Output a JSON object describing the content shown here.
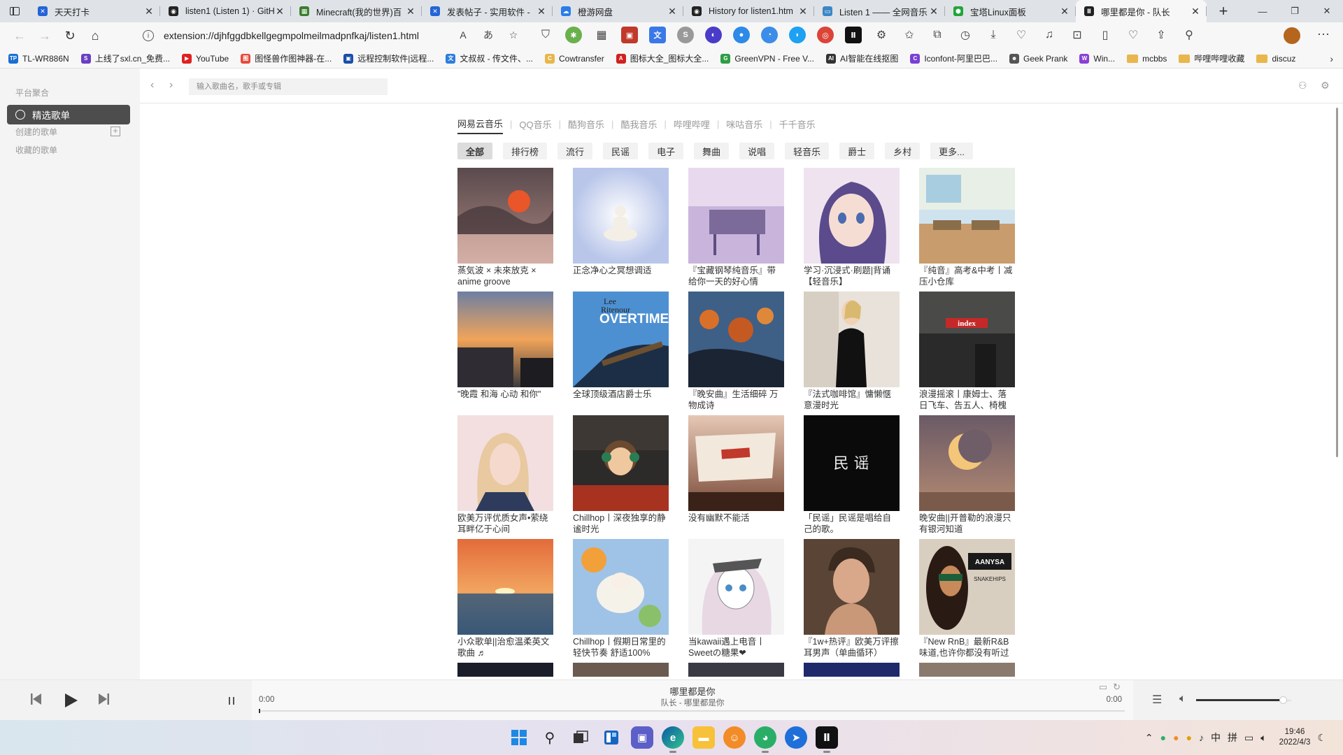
{
  "browser": {
    "tabs": [
      {
        "title": "天天打卡",
        "color": "#2464d6",
        "glyph": "✕"
      },
      {
        "title": "listen1 (Listen 1) · GitH",
        "color": "#222222",
        "glyph": "◉"
      },
      {
        "title": "Minecraft(我的世界)百",
        "color": "#3a7d2e",
        "glyph": "▦"
      },
      {
        "title": "发表帖子 - 实用软件 -",
        "color": "#2464d6",
        "glyph": "✕"
      },
      {
        "title": "橙游网盘",
        "color": "#2b7de9",
        "glyph": "☁"
      },
      {
        "title": "History for listen1.htm",
        "color": "#222222",
        "glyph": "◉"
      },
      {
        "title": "Listen 1 —— 全网音乐",
        "color": "#3b87c5",
        "glyph": "▭"
      },
      {
        "title": "宝塔Linux面板",
        "color": "#20a53a",
        "glyph": "⬢"
      },
      {
        "title": "哪里都是你 - 队长",
        "color": "#222222",
        "glyph": "Ⅱ",
        "active": true
      }
    ],
    "url": "extension://djhfggdbkellgegmpolmeilmadpnfkaj/listen1.html",
    "bookmarks": [
      {
        "label": "TL-WR886N",
        "color": "#1a6fd1",
        "icon": "TP"
      },
      {
        "label": "上线了sxl.cn_免费...",
        "color": "#6a3fc2",
        "icon": "S"
      },
      {
        "label": "YouTube",
        "color": "#e02020",
        "icon": "▶"
      },
      {
        "label": "图怪兽作图神器-在...",
        "color": "#e64a3c",
        "icon": "图"
      },
      {
        "label": "远程控制软件|远程...",
        "color": "#1a4fa8",
        "icon": "▣"
      },
      {
        "label": "文叔叔 - 传文件、...",
        "color": "#2d7ddc",
        "icon": "文"
      },
      {
        "label": "Cowtransfer",
        "color": "#e8b64c",
        "icon": "C"
      },
      {
        "label": "图标大全_图标大全...",
        "color": "#d22020",
        "icon": "A"
      },
      {
        "label": "GreenVPN - Free V...",
        "color": "#2e9e45",
        "icon": "G"
      },
      {
        "label": "AI智能在线抠图",
        "color": "#333333",
        "icon": "AI"
      },
      {
        "label": "Iconfont-阿里巴巴...",
        "color": "#7a3fd6",
        "icon": "C"
      },
      {
        "label": "Geek Prank",
        "color": "#555555",
        "icon": "☻"
      },
      {
        "label": "Win...",
        "color": "#8b3fd6",
        "icon": "W"
      },
      {
        "label": "mcbbs",
        "color": "",
        "icon": "folder"
      },
      {
        "label": "哔哩哔哩收藏",
        "color": "",
        "icon": "folder"
      },
      {
        "label": "discuz",
        "color": "",
        "icon": "folder"
      }
    ]
  },
  "app": {
    "sidebar": {
      "section1": "平台聚合",
      "active_item": "精选歌单",
      "created": "创建的歌单",
      "collected": "收藏的歌单"
    },
    "search_placeholder": "输入歌曲名，歌手或专辑",
    "platforms": [
      "网易云音乐",
      "QQ音乐",
      "酷狗音乐",
      "酷我音乐",
      "哔哩哔哩",
      "咪咕音乐",
      "千千音乐"
    ],
    "filters": [
      "全部",
      "排行榜",
      "流行",
      "民谣",
      "电子",
      "舞曲",
      "说唱",
      "轻音乐",
      "爵士",
      "乡村",
      "更多..."
    ],
    "playlists": [
      {
        "title": "蒸気波 × 未來放克 × anime groove",
        "art": "sunset"
      },
      {
        "title": "正念净心之冥想调适",
        "art": "meditation"
      },
      {
        "title": "『宝藏钢琴纯音乐』带给你一天的好心情",
        "art": "piano"
      },
      {
        "title": "学习·沉浸式·刷题|背诵【轻音乐】",
        "art": "anime-girl"
      },
      {
        "title": "『纯音』高考&中考丨减压小仓库",
        "art": "classroom"
      },
      {
        "title": "\"晚霞 和海 心动 和你\"",
        "art": "sky"
      },
      {
        "title": "全球顶级酒店爵士乐",
        "art": "overtime",
        "cover_text": [
          "Lee",
          "Ritenour",
          "OVERTIME"
        ]
      },
      {
        "title": "『晚安曲』生活细碎 万物成诗",
        "art": "flowers"
      },
      {
        "title": "『法式咖啡馆』慵懒惬意漫时光",
        "art": "woman"
      },
      {
        "title": "浪漫摇滚丨康姆士、落日飞车、告五人、椅槐",
        "art": "index",
        "cover_text": [
          "index"
        ]
      },
      {
        "title": "欧美万评优质女声•萦绕耳畔亿于心间",
        "art": "blonde"
      },
      {
        "title": "Chillhop丨深夜独享的静谧时光",
        "art": "lofi"
      },
      {
        "title": "没有幽默不能活",
        "art": "banner"
      },
      {
        "title": "「民谣」民谣是唱给自己的歌。",
        "art": "minyao",
        "cover_text": [
          "民 谣"
        ]
      },
      {
        "title": "晚安曲||开普勒的浪漫只有银河知道",
        "art": "moon"
      },
      {
        "title": "小众歌单||治愈温柔英文歌曲 ♬",
        "art": "sea-sunset"
      },
      {
        "title": "Chillhop丨假期日常里的轻快节奏 舒适100%",
        "art": "lamb"
      },
      {
        "title": "当kawaii遇上电音丨Sweetの糖果❤",
        "art": "sketch"
      },
      {
        "title": "『1w+热评』欧美万评擦耳男声（单曲循环）",
        "art": "man"
      },
      {
        "title": "『New RnB』最新R&B味道,也许你都没有听过",
        "art": "aanysa",
        "cover_text": [
          "AANYSA",
          "SNAKEHIPS"
        ]
      }
    ],
    "player": {
      "song": "哪里都是你",
      "artist_line": "队长 - 哪里都是你",
      "time_current": "0:00",
      "time_total": "0:00",
      "progress": 0,
      "volume": 0.91
    }
  },
  "taskbar": {
    "ime_lang": "中",
    "ime_mode": "拼",
    "time": "19:46",
    "date": "2022/4/3"
  }
}
